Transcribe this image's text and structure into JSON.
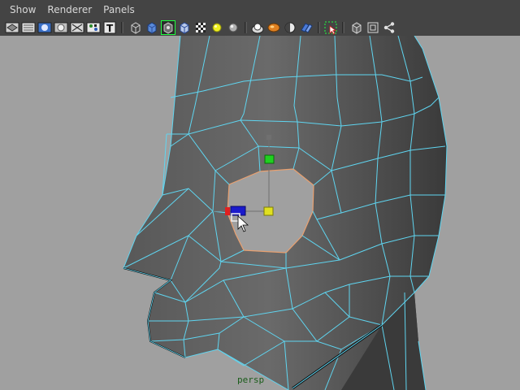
{
  "menu": {
    "items": [
      {
        "label": "Show",
        "name": "menu-show"
      },
      {
        "label": "Renderer",
        "name": "menu-renderer"
      },
      {
        "label": "Panels",
        "name": "menu-panels"
      }
    ]
  },
  "toolbar": {
    "icons": [
      "select-camera-icon",
      "film-gate-icon",
      "grid-icon",
      "resolution-gate-icon",
      "safe-action-icon",
      "isolate-select-icon",
      "texture-display-icon",
      "wireframe-icon",
      "smooth-shade-icon",
      "wireframe-on-shaded-icon",
      "xray-icon",
      "use-default-material-icon",
      "all-lights-icon",
      "default-light-icon",
      "shadows-icon",
      "high-quality-icon",
      "ambient-occlusion-icon",
      "depth-of-field-icon",
      "motion-blur-icon",
      "select-highlight-icon",
      "backface-culling-icon",
      "frame-icon",
      "share-icon"
    ]
  },
  "colors": {
    "wireframe": "#5fd5f0",
    "selected_edge": "#e8a070",
    "manipulator_x": "#e02020",
    "manipulator_y": "#20d020",
    "manipulator_z": "#1a1acc",
    "manipulator_center": "#e0e020"
  },
  "viewport": {
    "camera_label": "persp"
  }
}
